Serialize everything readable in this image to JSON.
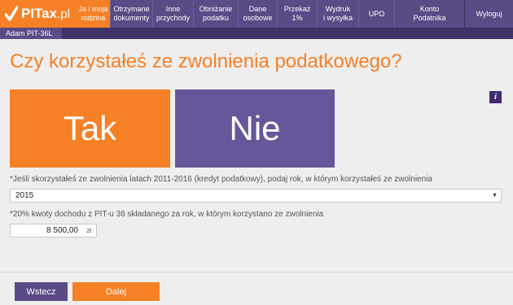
{
  "brand": {
    "logo_main": "PITax",
    "logo_suffix": ".pl"
  },
  "nav": {
    "items": [
      {
        "label": "Ja i moja\nrodzina",
        "active": true
      },
      {
        "label": "Otrzymane\ndokumenty",
        "active": false
      },
      {
        "label": "Inne\nprzychody",
        "active": false
      },
      {
        "label": "Obniżanie\npodatku",
        "active": false
      },
      {
        "label": "Dane\nosobowe",
        "active": false
      },
      {
        "label": "Przekaż\n1%",
        "active": false
      },
      {
        "label": "Wydruk\ni wysyłka",
        "active": false
      },
      {
        "label": "UPO",
        "active": false
      },
      {
        "label": "Konto\nPodatnika",
        "active": false
      },
      {
        "label": "Wyloguj",
        "active": false
      }
    ]
  },
  "subbar": {
    "user_tab": "Adam PIT-36L"
  },
  "main": {
    "title": "Czy korzystałeś ze zwolnienia podatkowego?",
    "info_label": "i",
    "choice_yes": "Tak",
    "choice_no": "Nie",
    "year_label_req": "*",
    "year_label": "Jeśli skorzystałeś ze zwolnienia latach 2011-2016 (kredyt podatkowy), podaj rok, w którym korzystałeś ze zwolnienia",
    "year_value": "2015",
    "amount_label_req": "*",
    "amount_label": "20% kwoty dochodu z PIT-u 36 składanego za rok, w którym korzystano ze zwolnienia",
    "amount_value": "8 500,00",
    "amount_unit": "zł"
  },
  "footer": {
    "back_label": "Wstecz",
    "next_label": "Dalej"
  },
  "colors": {
    "accent": "#f58025",
    "brand": "#5a4a85",
    "dark": "#3e3266"
  }
}
